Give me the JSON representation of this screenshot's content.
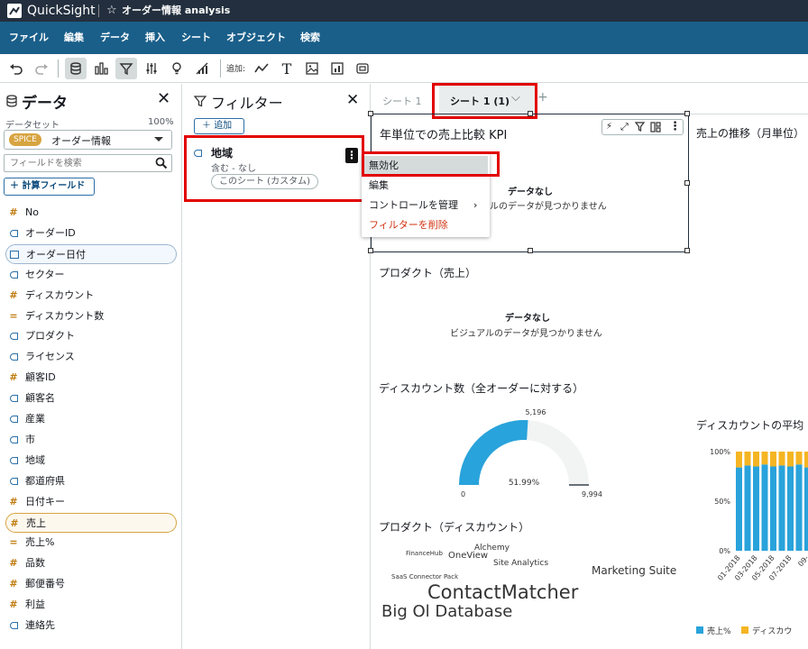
{
  "topbar": {
    "app_name": "QuickSight",
    "analysis_title": "オーダー情報 analysis"
  },
  "menu": [
    "ファイル",
    "編集",
    "データ",
    "挿入",
    "シート",
    "オブジェクト",
    "検索"
  ],
  "toolbar": {
    "add_label": "追加:"
  },
  "data_panel": {
    "title": "データ",
    "dataset_label": "データセット",
    "dataset_percent": "100%",
    "spice_badge": "SPICE",
    "dataset_name": "オーダー情報",
    "search_placeholder": "フィールドを検索",
    "calc_field_label": "計算フィールド",
    "fields": [
      {
        "name": "No",
        "type": "#"
      },
      {
        "name": "オーダーID",
        "type": "dim"
      },
      {
        "name": "オーダー日付",
        "type": "date"
      },
      {
        "name": "セクター",
        "type": "dim"
      },
      {
        "name": "ディスカウント",
        "type": "#"
      },
      {
        "name": "ディスカウント数",
        "type": "="
      },
      {
        "name": "プロダクト",
        "type": "dim"
      },
      {
        "name": "ライセンス",
        "type": "dim"
      },
      {
        "name": "顧客ID",
        "type": "#"
      },
      {
        "name": "顧客名",
        "type": "dim"
      },
      {
        "name": "産業",
        "type": "dim"
      },
      {
        "name": "市",
        "type": "dim"
      },
      {
        "name": "地域",
        "type": "dim"
      },
      {
        "name": "都道府県",
        "type": "dim"
      },
      {
        "name": "日付キー",
        "type": "#"
      },
      {
        "name": "売上",
        "type": "#"
      },
      {
        "name": "売上%",
        "type": "="
      },
      {
        "name": "品数",
        "type": "#"
      },
      {
        "name": "郵便番号",
        "type": "#"
      },
      {
        "name": "利益",
        "type": "#"
      },
      {
        "name": "連絡先",
        "type": "dim"
      }
    ]
  },
  "filter_panel": {
    "title": "フィルター",
    "add_label": "追加",
    "filter": {
      "name": "地域",
      "condition": "含む - なし",
      "scope": "このシート (カスタム)"
    },
    "context_menu": [
      "無効化",
      "編集",
      "コントロールを管理",
      "フィルターを削除"
    ]
  },
  "sheets": {
    "tab1": "シート 1",
    "tab2": "シート 1 (1)"
  },
  "visuals": {
    "kpi_title": "年単位での売上比較 KPI",
    "no_data": "データなし",
    "no_data_sub": "ビジュアルのデータが見つかりません",
    "no_data_sub_partial": "ルのデータが見つかりません",
    "trend_title": "売上の推移（月単位）",
    "product_sales_title": "プロダクト（売上）",
    "discount_count_title": "ディスカウント数（全オーダーに対する）",
    "discount_avg_title": "ディスカウントの平均",
    "product_discount_title": "プロダクト（ディスカウント）"
  },
  "chart_data": [
    {
      "type": "gauge",
      "title": "ディスカウント数（全オーダーに対する）",
      "value": 5196,
      "max": 9994,
      "min": 0,
      "percent_label": "51.99%",
      "value_label": "5,196",
      "max_label": "9,994",
      "min_label": "0"
    },
    {
      "type": "bar",
      "title": "ディスカウントの平均",
      "stacked": true,
      "yticks": [
        "0%",
        "50%",
        "100%"
      ],
      "xticks": [
        "01-2018",
        "03-2018",
        "05-2018",
        "07-2018",
        "09-"
      ],
      "series": [
        {
          "name": "売上%",
          "color": "#29a3db",
          "values": [
            0.84,
            0.86,
            0.85,
            0.87,
            0.85,
            0.86,
            0.85,
            0.87,
            0.84,
            0.86,
            0.85,
            0.86,
            0.85
          ]
        },
        {
          "name": "ディスカウ",
          "color": "#f5b523",
          "values": [
            0.16,
            0.14,
            0.15,
            0.13,
            0.15,
            0.14,
            0.15,
            0.13,
            0.16,
            0.14,
            0.15,
            0.14,
            0.15
          ]
        }
      ]
    },
    {
      "type": "wordcloud",
      "title": "プロダクト（ディスカウント）",
      "words": [
        "ContactMatcher",
        "Big Ol Database",
        "Marketing Suite",
        "Site Analytics",
        "Alchemy",
        "OneView",
        "FinanceHub",
        "SaaS Connector Pack"
      ]
    }
  ]
}
